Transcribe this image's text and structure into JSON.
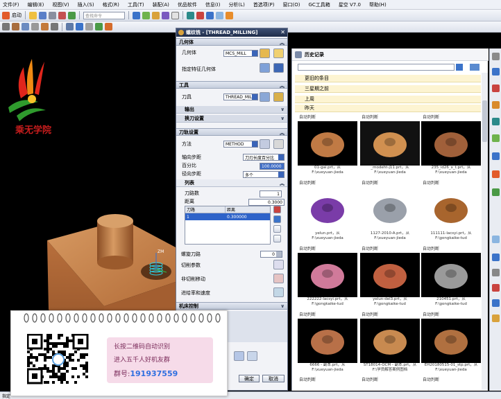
{
  "menu": [
    "文件(F)",
    "编辑(E)",
    "视图(V)",
    "插入(S)",
    "格式(R)",
    "工具(T)",
    "装配(A)",
    "优品软件",
    "信息(I)",
    "分析(L)",
    "首选项(P)",
    "窗口(O)",
    "GC工具箱",
    "星空 V7.0",
    "帮助(H)"
  ],
  "toolbar": {
    "start_label": "启动",
    "search_placeholder": "查找命令"
  },
  "dialog": {
    "title": "螺纹铣 - [THREAD_MILLING]",
    "geometry_section": "几何体",
    "geometry_label": "几何体",
    "geometry_value": "MCS_MILL",
    "feature_geometry_label": "指定特征几何体",
    "tool_section": "工具",
    "tool_label": "刀具",
    "tool_value": "THREAD_MILL",
    "output_label": "输出",
    "tool_change_label": "换刀设置",
    "path_section": "刀轨设置",
    "method_label": "方法",
    "method_value": "METHOD",
    "axial_step_label": "轴向步距",
    "axial_step_value": "刀刃长度百分比",
    "percent_label": "百分比",
    "percent_value": "100.0000",
    "radial_step_label": "径向步距",
    "radial_step_value": "多个",
    "list_label": "列表",
    "path_count_label": "刀路数",
    "path_count_value": "1",
    "distance_label": "距离",
    "distance_value": "0.3000",
    "table_headers": [
      "刀路",
      "距离"
    ],
    "table_rows": [
      [
        "1",
        "0.300000"
      ]
    ],
    "spiral_label": "螺旋刀路",
    "spiral_value": "0",
    "cut_params_label": "切削参数",
    "non_cut_label": "非切削移动",
    "feeds_label": "进给率和速度",
    "machine_section": "机床控制",
    "ok_label": "确定",
    "cancel_label": "取消"
  },
  "history": {
    "title": "历史记录",
    "groups": [
      "更旧的条目",
      "三星期之前",
      "上周",
      "昨天"
    ],
    "thumb_label": "自动判断",
    "items": [
      {
        "cap1": "01-gai.prt，从",
        "cap2": "F:\\xueyuan-jieda"
      },
      {
        "cap1": "_modeht-j11.prt，从",
        "cap2": "F:\\xueyuan-jieda"
      },
      {
        "cap1": "235_id26_x_t.prt，从",
        "cap2": "F:\\xueyuan-jieda"
      },
      {
        "cap1": "yelun.prt，从",
        "cap2": "F:\\xueyuan-jieda"
      },
      {
        "cap1": "1127-2010-A.prt，从",
        "cap2": "F:\\xueyuan-jieda"
      },
      {
        "cap1": "111111-lacsyi.prt，从",
        "cap2": "F:\\gongkaike-tud"
      },
      {
        "cap1": "222222-lacsyi.prt，从",
        "cap2": "F:\\gongkaike-tud"
      },
      {
        "cap1": "yelun-del3.prt，从",
        "cap2": "F:\\gongkaike-tud"
      },
      {
        "cap1": "210451.prt，从",
        "cap2": "F:\\gongkaike-tud"
      },
      {
        "cap1": "6666 - 副本.prt，从",
        "cap2": "F:\\xueyuan-jieda"
      },
      {
        "cap1": "ST18014-OCM - 副本.prt，从",
        "cap2": "F:\\学员解答案例图档"
      },
      {
        "cap1": "EH20180515-01_stp.prt，从",
        "cap2": "F:\\xueyuan-jieda"
      }
    ]
  },
  "status_text": "指定",
  "logo_text": "乘无学院",
  "popup": {
    "line1": "长按二维码自动识别",
    "line2": "进入五千人好机友群",
    "group_label": "群号:",
    "group_number": "191937559"
  },
  "colors": {
    "accent": "#2e63c9",
    "part": "#c07a45",
    "banner": "#fdf4d2"
  }
}
